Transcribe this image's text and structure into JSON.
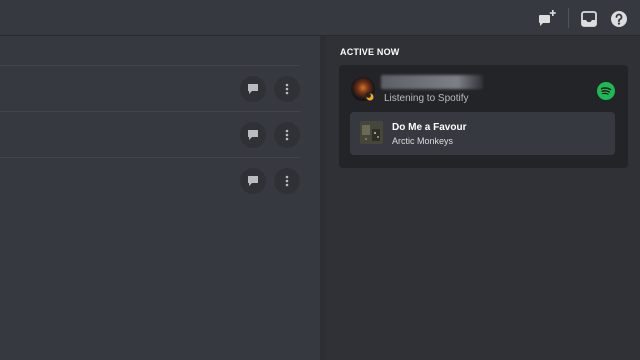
{
  "active_now": {
    "title": "ACTIVE NOW",
    "activity": {
      "status_text": "Listening to Spotify",
      "service_icon": "spotify-icon",
      "track": {
        "title": "Do Me a Favour",
        "artist": "Arctic Monkeys"
      }
    }
  },
  "toolbar": {
    "icons": [
      "new-group-dm-icon",
      "inbox-icon",
      "help-icon"
    ]
  },
  "friend_rows": [
    {
      "actions": [
        "message-icon",
        "more-icon"
      ]
    },
    {
      "actions": [
        "message-icon",
        "more-icon"
      ]
    },
    {
      "actions": [
        "message-icon",
        "more-icon"
      ]
    }
  ],
  "colors": {
    "background": "#36393f",
    "sidebar": "#2f3136",
    "card": "#232428",
    "spotify_green": "#1db954",
    "idle_moon": "#faa61a"
  }
}
